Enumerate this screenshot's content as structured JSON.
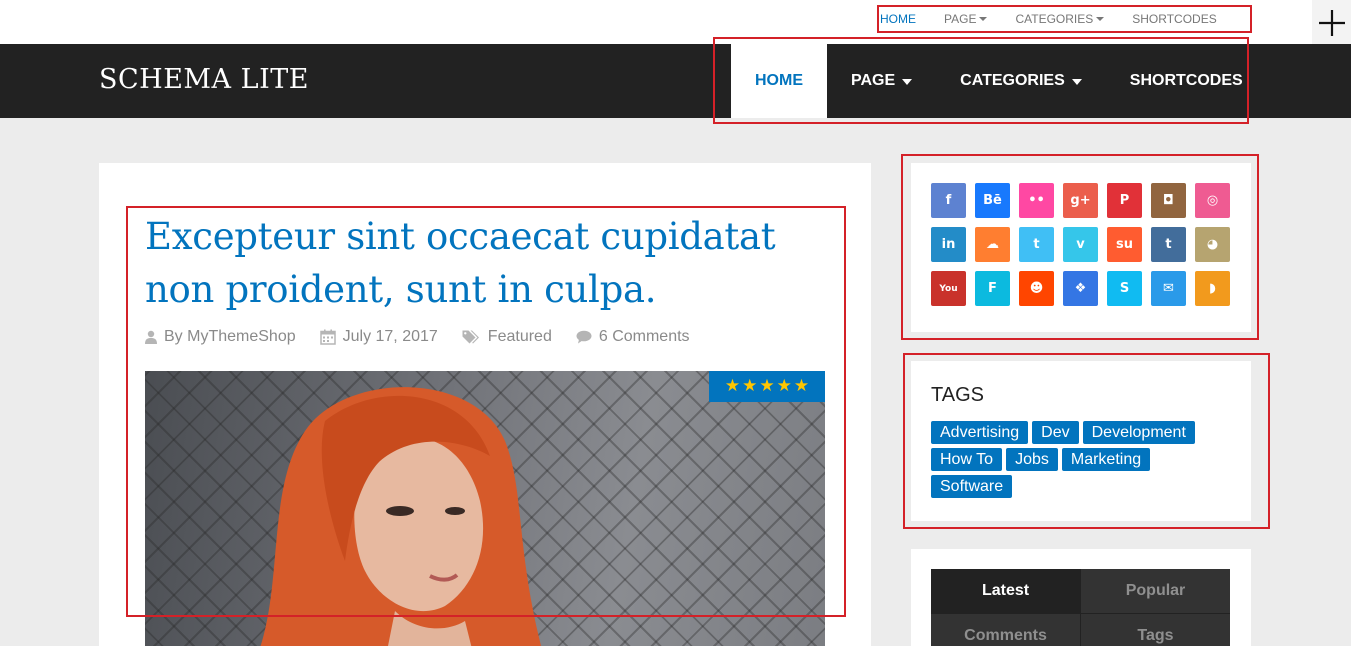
{
  "top_nav": {
    "items": [
      {
        "label": "HOME",
        "active": true,
        "dropdown": false
      },
      {
        "label": "PAGE",
        "active": false,
        "dropdown": true
      },
      {
        "label": "CATEGORIES",
        "active": false,
        "dropdown": true
      },
      {
        "label": "SHORTCODES",
        "active": false,
        "dropdown": false
      }
    ]
  },
  "header": {
    "site_title": "SCHEMA LITE",
    "nav": [
      {
        "label": "HOME",
        "active": true,
        "dropdown": false
      },
      {
        "label": "PAGE",
        "active": false,
        "dropdown": true
      },
      {
        "label": "CATEGORIES",
        "active": false,
        "dropdown": true
      },
      {
        "label": "SHORTCODES",
        "active": false,
        "dropdown": false
      }
    ]
  },
  "post": {
    "title": "Excepteur sint occaecat cupidatat non proident, sunt in culpa.",
    "author": "By MyThemeShop",
    "date": "July 17, 2017",
    "category": "Featured",
    "comments": "6 Comments",
    "rating_stars": 5
  },
  "social_icons": [
    {
      "name": "facebook-icon",
      "glyph": "f",
      "color": "#5d82d1"
    },
    {
      "name": "behance-icon",
      "glyph": "Bē",
      "color": "#1879fd"
    },
    {
      "name": "flickr-icon",
      "glyph": "••",
      "color": "#ff48a3"
    },
    {
      "name": "google-plus-icon",
      "glyph": "g+",
      "color": "#eb5e4c"
    },
    {
      "name": "pinterest-icon",
      "glyph": "P",
      "color": "#e13138"
    },
    {
      "name": "instagram-icon",
      "glyph": "◘",
      "color": "#91653f"
    },
    {
      "name": "dribbble-icon",
      "glyph": "◎",
      "color": "#ef5b92"
    },
    {
      "name": "linkedin-icon",
      "glyph": "in",
      "color": "#238cc8"
    },
    {
      "name": "soundcloud-icon",
      "glyph": "☁",
      "color": "#ff7e30"
    },
    {
      "name": "twitter-icon",
      "glyph": "t",
      "color": "#40bff5"
    },
    {
      "name": "vimeo-icon",
      "glyph": "v",
      "color": "#35c6ea"
    },
    {
      "name": "stumbleupon-icon",
      "glyph": "su",
      "color": "#ff5c30"
    },
    {
      "name": "tumblr-icon",
      "glyph": "t",
      "color": "#426d9b"
    },
    {
      "name": "github-icon",
      "glyph": "◕",
      "color": "#b6a470"
    },
    {
      "name": "youtube-icon",
      "glyph": "You",
      "color": "#c9322b"
    },
    {
      "name": "foursquare-icon",
      "glyph": "F",
      "color": "#0cbadf"
    },
    {
      "name": "reddit-icon",
      "glyph": "☻",
      "color": "#ff4500"
    },
    {
      "name": "dropbox-icon",
      "glyph": "❖",
      "color": "#3476e4"
    },
    {
      "name": "skype-icon",
      "glyph": "S",
      "color": "#10bbf2"
    },
    {
      "name": "email-icon",
      "glyph": "✉",
      "color": "#2a9ae9"
    },
    {
      "name": "rss-icon",
      "glyph": "◗",
      "color": "#f29a1d"
    }
  ],
  "tags_widget": {
    "title": "TAGS",
    "tags": [
      "Advertising",
      "Dev",
      "Development",
      "How To",
      "Jobs",
      "Marketing",
      "Software"
    ]
  },
  "tabs_widget": {
    "tabs": [
      {
        "label": "Latest",
        "active": true
      },
      {
        "label": "Popular",
        "active": false
      },
      {
        "label": "Comments",
        "active": false
      },
      {
        "label": "Tags",
        "active": false
      }
    ]
  },
  "colors": {
    "accent": "#0274be",
    "header_bg": "#222222",
    "page_bg": "#ececec",
    "highlight": "#d42128",
    "star": "#ffc600"
  }
}
